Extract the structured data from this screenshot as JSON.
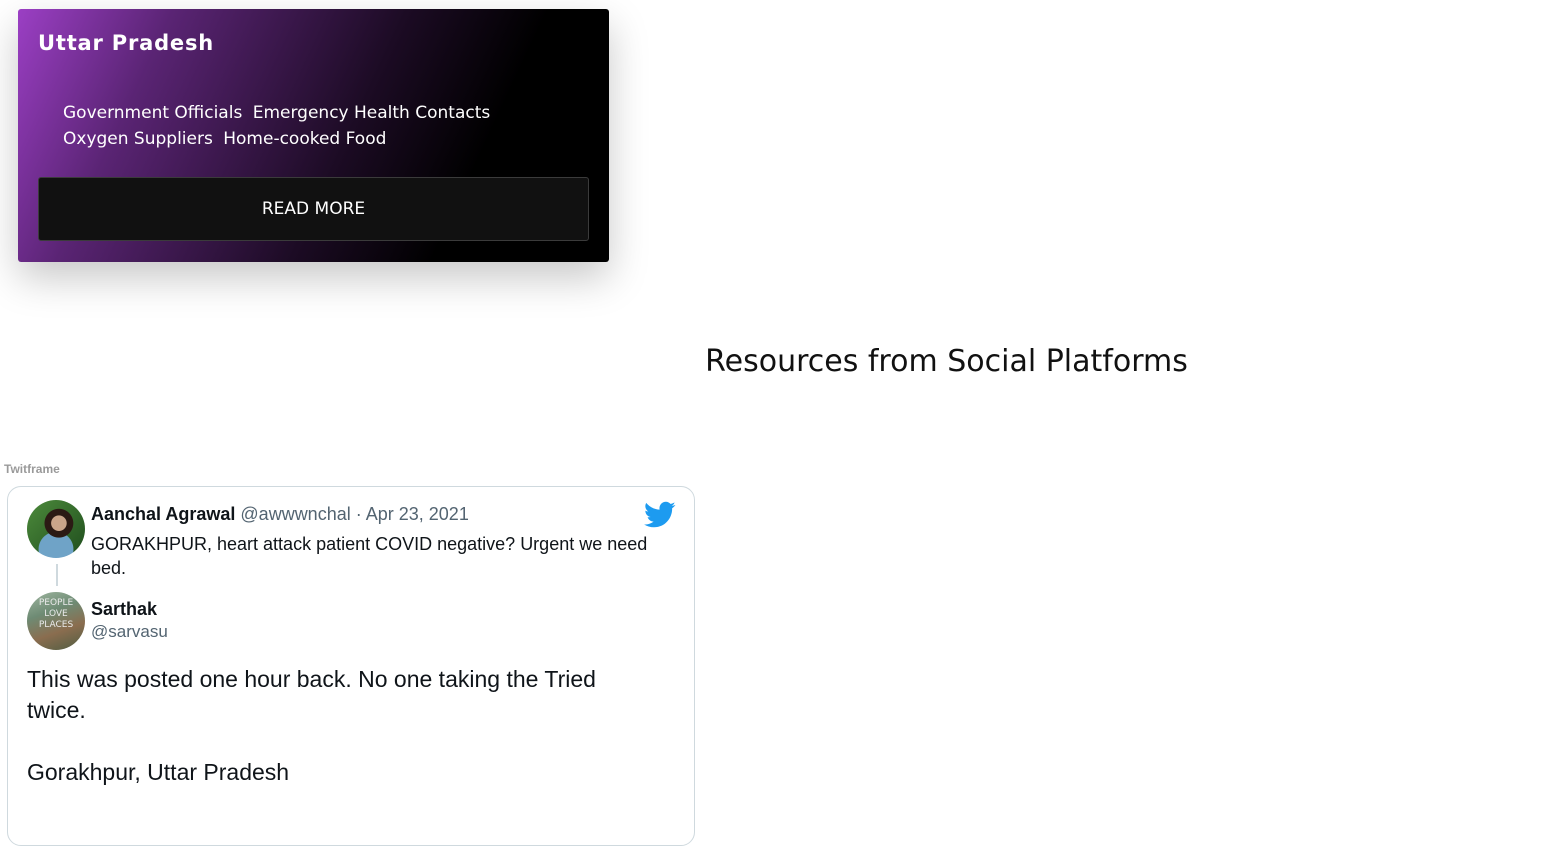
{
  "card": {
    "title": "Uttar Pradesh",
    "links": [
      "Government Officials",
      "Emergency Health Contacts",
      "Oxygen Suppliers",
      "Home-cooked Food"
    ],
    "button_label": "READ MORE",
    "gradient_colors": [
      "#9b3fc4",
      "#000000"
    ]
  },
  "section": {
    "heading": "Resources from Social Platforms"
  },
  "embed": {
    "label": "Twitframe"
  },
  "tweet": {
    "reply": {
      "author_name": "Aanchal Agrawal",
      "author_handle": "@awwwnchal",
      "separator": "·",
      "date": "Apr 23, 2021",
      "text": "GORAKHPUR, heart attack patient COVID negative? Urgent we need bed."
    },
    "main": {
      "author_name": "Sarthak",
      "author_handle": "@sarvasu",
      "avatar_text": [
        "PEOPLE",
        "LOVE",
        "PLACES"
      ],
      "text_line_1": "This was posted one hour back. No one taking the Tried twice.",
      "text_line_2": "Gorakhpur, Uttar Pradesh"
    },
    "brand_color": "#1d9bf0",
    "icon": "twitter-bird-icon"
  }
}
